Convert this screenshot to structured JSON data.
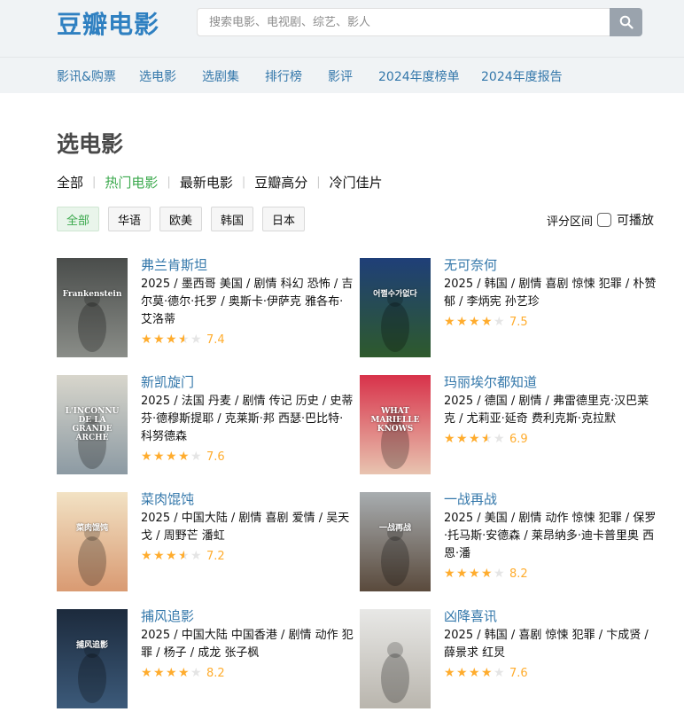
{
  "header": {
    "logo": "豆瓣电影",
    "search_placeholder": "搜索电影、电视剧、综艺、影人"
  },
  "nav": [
    "影讯&购票",
    "选电影",
    "选剧集",
    "排行榜",
    "影评",
    "2024年度榜单",
    "2024年度报告"
  ],
  "page_title": "选电影",
  "tags": [
    {
      "label": "全部",
      "active": false
    },
    {
      "label": "热门电影",
      "active": true
    },
    {
      "label": "最新电影",
      "active": false
    },
    {
      "label": "豆瓣高分",
      "active": false
    },
    {
      "label": "冷门佳片",
      "active": false
    }
  ],
  "filters": [
    {
      "label": "全部",
      "active": true
    },
    {
      "label": "华语",
      "active": false
    },
    {
      "label": "欧美",
      "active": false
    },
    {
      "label": "韩国",
      "active": false
    },
    {
      "label": "日本",
      "active": false
    }
  ],
  "range_label": "评分区间",
  "playable_label": "可播放",
  "movies": [
    {
      "title": "弗兰肯斯坦",
      "meta": "2025 / 墨西哥 美国 / 剧情 科幻 恐怖 / 吉尔莫·德尔·托罗 / 奥斯卡·伊萨克 雅各布·艾洛蒂",
      "stars": 3.5,
      "score": "7.4",
      "poster_text": "Frankenstein",
      "poster_colors": [
        "#4a4d4b",
        "#8a8d88"
      ]
    },
    {
      "title": "无可奈何",
      "meta": "2025 / 韩国 / 剧情 喜剧 惊悚 犯罪 / 朴赞郁 / 李炳宪 孙艺珍",
      "stars": 4,
      "score": "7.5",
      "poster_text": "어쩔수가없다",
      "poster_colors": [
        "#1f3f78",
        "#2e5a2c"
      ]
    },
    {
      "title": "新凯旋门",
      "meta": "2025 / 法国 丹麦 / 剧情 传记 历史 / 史蒂芬·德穆斯提耶 / 克莱斯·邦 西瑟·巴比特·科努德森",
      "stars": 4,
      "score": "7.6",
      "poster_text": "L'INCONNU DE LA GRANDE ARCHE",
      "poster_colors": [
        "#d8d6cc",
        "#8c9aa3"
      ]
    },
    {
      "title": "玛丽埃尔都知道",
      "meta": "2025 / 德国 / 剧情 / 弗雷德里克·汉巴莱克 / 尤莉亚·延奇 费利克斯·克拉默",
      "stars": 3.5,
      "score": "6.9",
      "poster_text": "WHAT MARIELLE KNOWS",
      "poster_colors": [
        "#d8324a",
        "#e8c4b0"
      ]
    },
    {
      "title": "菜肉馄饨",
      "meta": "2025 / 中国大陆 / 剧情 喜剧 爱情 / 吴天戈 / 周野芒 潘虹",
      "stars": 3.5,
      "score": "7.2",
      "poster_text": "菜肉馄饨",
      "poster_colors": [
        "#f2e2c4",
        "#d99a72"
      ]
    },
    {
      "title": "一战再战",
      "meta": "2025 / 美国 / 剧情 动作 惊悚 犯罪 / 保罗·托马斯·安德森 / 莱昂纳多·迪卡普里奥 西恩·潘",
      "stars": 4,
      "score": "8.2",
      "poster_text": "一战再战",
      "poster_colors": [
        "#a8adb0",
        "#5a4a3c"
      ]
    },
    {
      "title": "捕风追影",
      "meta": "2025 / 中国大陆 中国香港 / 剧情 动作 犯罪 / 杨子 / 成龙 张子枫",
      "stars": 4,
      "score": "8.2",
      "poster_text": "捕风追影",
      "poster_colors": [
        "#1c2a3c",
        "#3c5a7a"
      ]
    },
    {
      "title": "凶降喜讯",
      "meta": "2025 / 韩国 / 喜剧 惊悚 犯罪 / 卞成贤 / 薛景求 红炅",
      "stars": 4,
      "score": "7.6",
      "poster_text": "",
      "poster_colors": [
        "#e8e8e6",
        "#b9b5ad"
      ]
    }
  ]
}
